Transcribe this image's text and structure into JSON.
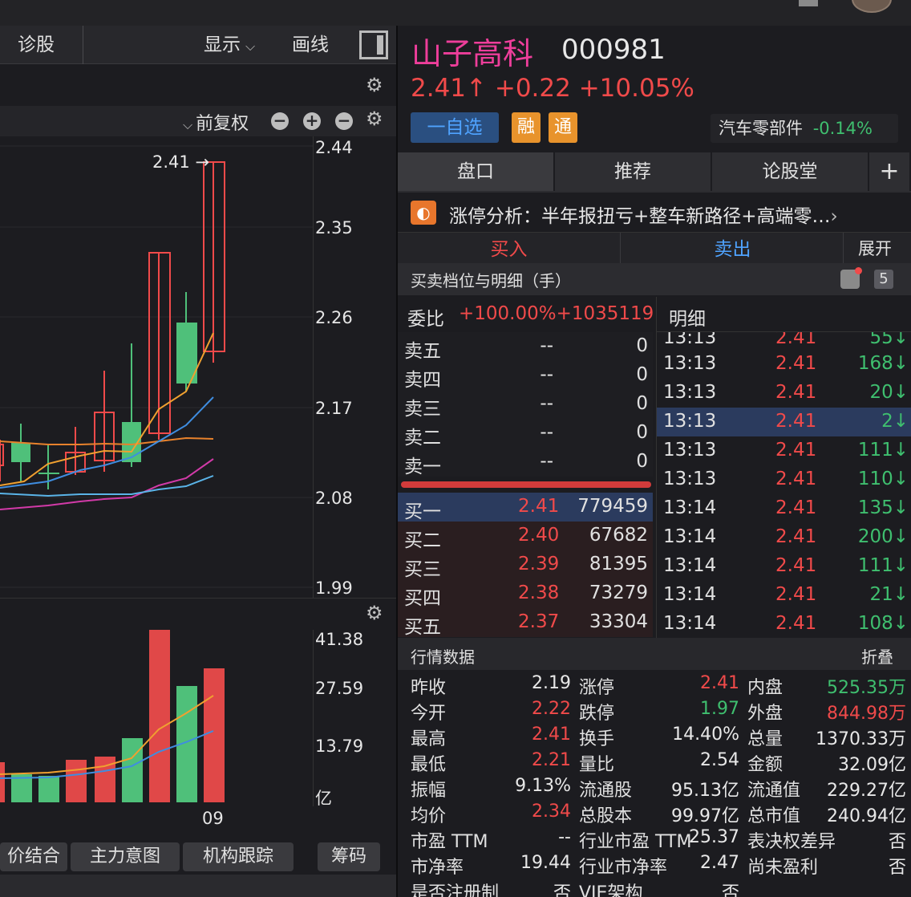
{
  "left_toolbar": {
    "diagnose": "诊股",
    "display": "显示",
    "draw": "画线"
  },
  "chart": {
    "adjust": "前复权",
    "price_axis": [
      "2.44",
      "2.35",
      "2.26",
      "2.17",
      "2.08",
      "1.99"
    ],
    "marker": "2.41",
    "volume_axis": [
      "41.38",
      "27.59",
      "13.79",
      "亿"
    ],
    "date_label": "09"
  },
  "bottom_tabs": [
    "价结合",
    "主力意图",
    "机构跟踪",
    "筹码"
  ],
  "stock": {
    "name": "山子高科",
    "code": "000981",
    "price_line": "2.41↑ +0.22 +10.05%",
    "watch": "一自选",
    "tag_margin": "融",
    "tag_connect": "通",
    "sector_name": "汽车零部件",
    "sector_change": "-0.14%"
  },
  "tabs": [
    "盘口",
    "推荐",
    "论股堂",
    "+"
  ],
  "limit_analysis": "涨停分析：半年报扭亏+整车新路径+高端零…",
  "trade": {
    "buy": "买入",
    "sell": "卖出",
    "expand": "展开"
  },
  "order_book": {
    "title": "买卖档位与明细（手）",
    "badge": "5",
    "ratio_label": "委比",
    "ratio_value": "+100.00%+1035119",
    "sell": [
      {
        "label": "卖五",
        "price": "--",
        "qty": "0"
      },
      {
        "label": "卖四",
        "price": "--",
        "qty": "0"
      },
      {
        "label": "卖三",
        "price": "--",
        "qty": "0"
      },
      {
        "label": "卖二",
        "price": "--",
        "qty": "0"
      },
      {
        "label": "卖一",
        "price": "--",
        "qty": "0"
      }
    ],
    "buy": [
      {
        "label": "买一",
        "price": "2.41",
        "qty": "779459"
      },
      {
        "label": "买二",
        "price": "2.40",
        "qty": "67682"
      },
      {
        "label": "买三",
        "price": "2.39",
        "qty": "81395"
      },
      {
        "label": "买四",
        "price": "2.38",
        "qty": "73279"
      },
      {
        "label": "买五",
        "price": "2.37",
        "qty": "33304"
      }
    ]
  },
  "ticks": {
    "title": "明细",
    "rows": [
      {
        "time": "13:13",
        "price": "2.41",
        "vol": "55↓"
      },
      {
        "time": "13:13",
        "price": "2.41",
        "vol": "168↓"
      },
      {
        "time": "13:13",
        "price": "2.41",
        "vol": "20↓"
      },
      {
        "time": "13:13",
        "price": "2.41",
        "vol": "2↓"
      },
      {
        "time": "13:13",
        "price": "2.41",
        "vol": "111↓"
      },
      {
        "time": "13:13",
        "price": "2.41",
        "vol": "110↓"
      },
      {
        "time": "13:14",
        "price": "2.41",
        "vol": "135↓"
      },
      {
        "time": "13:14",
        "price": "2.41",
        "vol": "200↓"
      },
      {
        "time": "13:14",
        "price": "2.41",
        "vol": "111↓"
      },
      {
        "time": "13:14",
        "price": "2.41",
        "vol": "21↓"
      },
      {
        "time": "13:14",
        "price": "2.41",
        "vol": "108↓"
      }
    ]
  },
  "quote": {
    "title": "行情数据",
    "fold": "折叠",
    "rows": [
      [
        {
          "k": "昨收",
          "v": "2.19",
          "c": "white"
        },
        {
          "k": "涨停",
          "v": "2.41",
          "c": "red"
        },
        {
          "k": "内盘",
          "v": "525.35万",
          "c": "green"
        }
      ],
      [
        {
          "k": "今开",
          "v": "2.22",
          "c": "red"
        },
        {
          "k": "跌停",
          "v": "1.97",
          "c": "green"
        },
        {
          "k": "外盘",
          "v": "844.98万",
          "c": "red"
        }
      ],
      [
        {
          "k": "最高",
          "v": "2.41",
          "c": "red"
        },
        {
          "k": "换手",
          "v": "14.40%",
          "c": "white"
        },
        {
          "k": "总量",
          "v": "1370.33万",
          "c": "white"
        }
      ],
      [
        {
          "k": "最低",
          "v": "2.21",
          "c": "red"
        },
        {
          "k": "量比",
          "v": "2.54",
          "c": "white"
        },
        {
          "k": "金额",
          "v": "32.09亿",
          "c": "white"
        }
      ],
      [
        {
          "k": "振幅",
          "v": "9.13%",
          "c": "white"
        },
        {
          "k": "流通股",
          "v": "95.13亿",
          "c": "white"
        },
        {
          "k": "流通值",
          "v": "229.27亿",
          "c": "white"
        }
      ],
      [
        {
          "k": "均价",
          "v": "2.34",
          "c": "red"
        },
        {
          "k": "总股本",
          "v": "99.97亿",
          "c": "white"
        },
        {
          "k": "总市值",
          "v": "240.94亿",
          "c": "white"
        }
      ],
      [
        {
          "k": "市盈 TTM",
          "v": "--",
          "c": "white"
        },
        {
          "k": "行业市盈 TTM",
          "v": "25.37",
          "c": "white"
        },
        {
          "k": "表决权差异",
          "v": "否",
          "c": "white"
        }
      ],
      [
        {
          "k": "市净率",
          "v": "19.44",
          "c": "white"
        },
        {
          "k": "行业市净率",
          "v": "2.47",
          "c": "white"
        },
        {
          "k": "尚未盈利",
          "v": "否",
          "c": "white"
        }
      ],
      [
        {
          "k": "是否注册制",
          "v": "否",
          "c": "white"
        },
        {
          "k": "VIE架构",
          "v": "否",
          "c": "white"
        },
        {
          "k": "",
          "v": "",
          "c": "white"
        }
      ]
    ]
  },
  "colors": {
    "up": "#f04a4a",
    "down": "#3fbf6f",
    "accent": "#4fa3ff",
    "name": "#ee3e9b"
  }
}
